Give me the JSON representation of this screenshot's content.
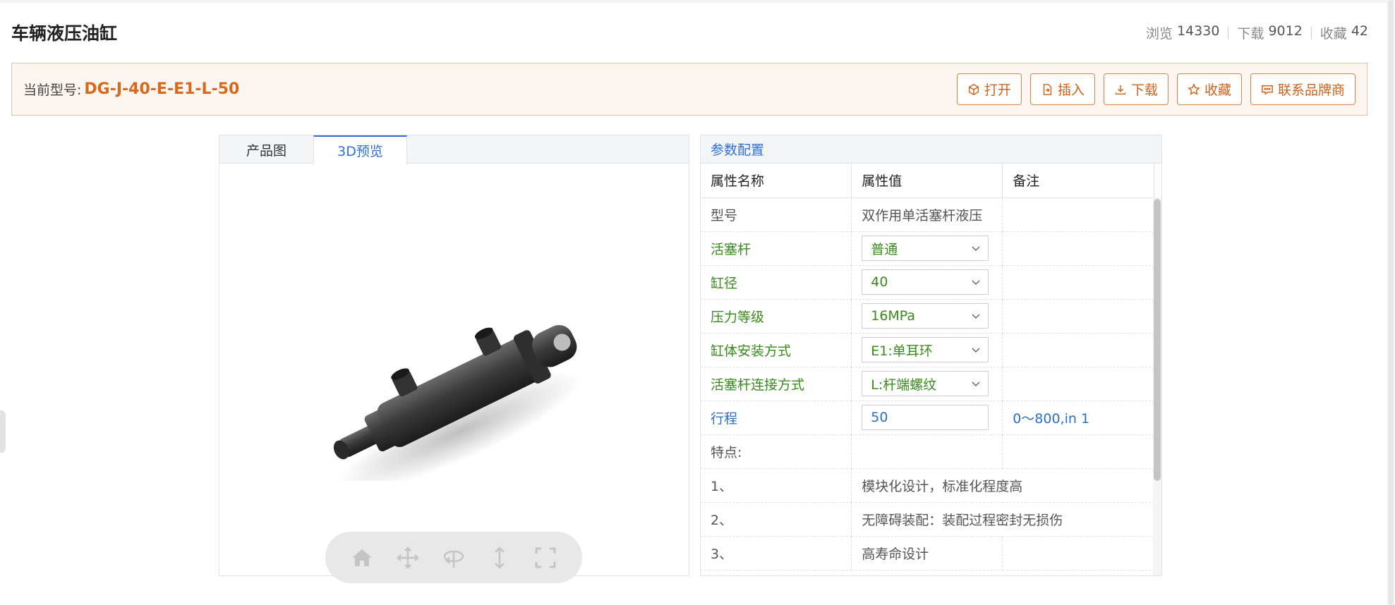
{
  "page": {
    "title": "车辆液压油缸",
    "stats": [
      {
        "label": "浏览",
        "value": "14330"
      },
      {
        "label": "下载",
        "value": "9012"
      },
      {
        "label": "收藏",
        "value": "42"
      }
    ]
  },
  "model": {
    "label": "当前型号:",
    "value": "DG-J-40-E-E1-L-50"
  },
  "actions": {
    "open": "打开",
    "insert": "插入",
    "download": "下载",
    "favorite": "收藏",
    "contact": "联系品牌商"
  },
  "tabs": {
    "product": "产品图",
    "preview3d": "3D预览"
  },
  "params": {
    "title": "参数配置",
    "headers": [
      "属性名称",
      "属性值",
      "备注"
    ],
    "rows": {
      "model": {
        "name": "型号",
        "value": "双作用单活塞杆液压"
      },
      "rod": {
        "name": "活塞杆",
        "value": "普通"
      },
      "bore": {
        "name": "缸径",
        "value": "40"
      },
      "pressure": {
        "name": "压力等级",
        "value": "16MPa"
      },
      "mount": {
        "name": "缸体安装方式",
        "value": "E1:单耳环"
      },
      "rod_conn": {
        "name": "活塞杆连接方式",
        "value": "L:杆端螺纹"
      },
      "stroke": {
        "name": "行程",
        "value": "50",
        "note": "0～800,in 1"
      },
      "features": {
        "name": "特点:"
      },
      "f1": {
        "name": "1、",
        "value": "模块化设计，标准化程度高"
      },
      "f2": {
        "name": "2、",
        "value": "无障碍装配：装配过程密封无损伤"
      },
      "f3": {
        "name": "3、",
        "value": "高寿命设计"
      }
    }
  },
  "colors": {
    "accent_orange": "#d8691c",
    "accent_blue": "#2f6fd6",
    "param_green": "#3a8a1e"
  },
  "icons": {
    "viewer_tools": [
      "home-icon",
      "move-icon",
      "rotate-icon",
      "vertical-move-icon",
      "fullscreen-icon"
    ]
  }
}
